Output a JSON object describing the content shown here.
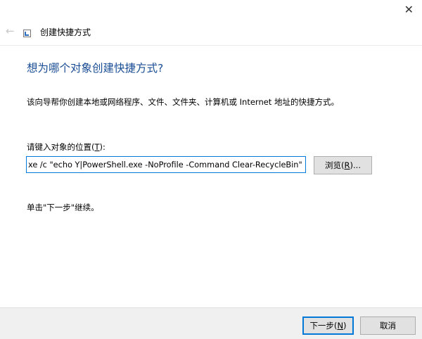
{
  "window": {
    "close_glyph": "✕",
    "back_glyph": "←",
    "title": "创建快捷方式"
  },
  "main": {
    "heading": "想为哪个对象创建快捷方式?",
    "description": "该向导帮你创建本地或网络程序、文件、文件夹、计算机或 Internet 地址的快捷方式。",
    "location_label_prefix": "请键入对象的位置(",
    "location_label_key": "T",
    "location_label_suffix": "):",
    "location_value": "xe /c \"echo Y|PowerShell.exe -NoProfile -Command Clear-RecycleBin\"",
    "browse_prefix": "浏览(",
    "browse_key": "R",
    "browse_suffix": ")...",
    "hint": "单击\"下一步\"继续。"
  },
  "footer": {
    "next_prefix": "下一步(",
    "next_key": "N",
    "next_suffix": ")",
    "cancel_label": "取消"
  },
  "colors": {
    "heading": "#1a4e96",
    "focus_border": "#0078d7",
    "footer_bg": "#f0f0f0"
  }
}
